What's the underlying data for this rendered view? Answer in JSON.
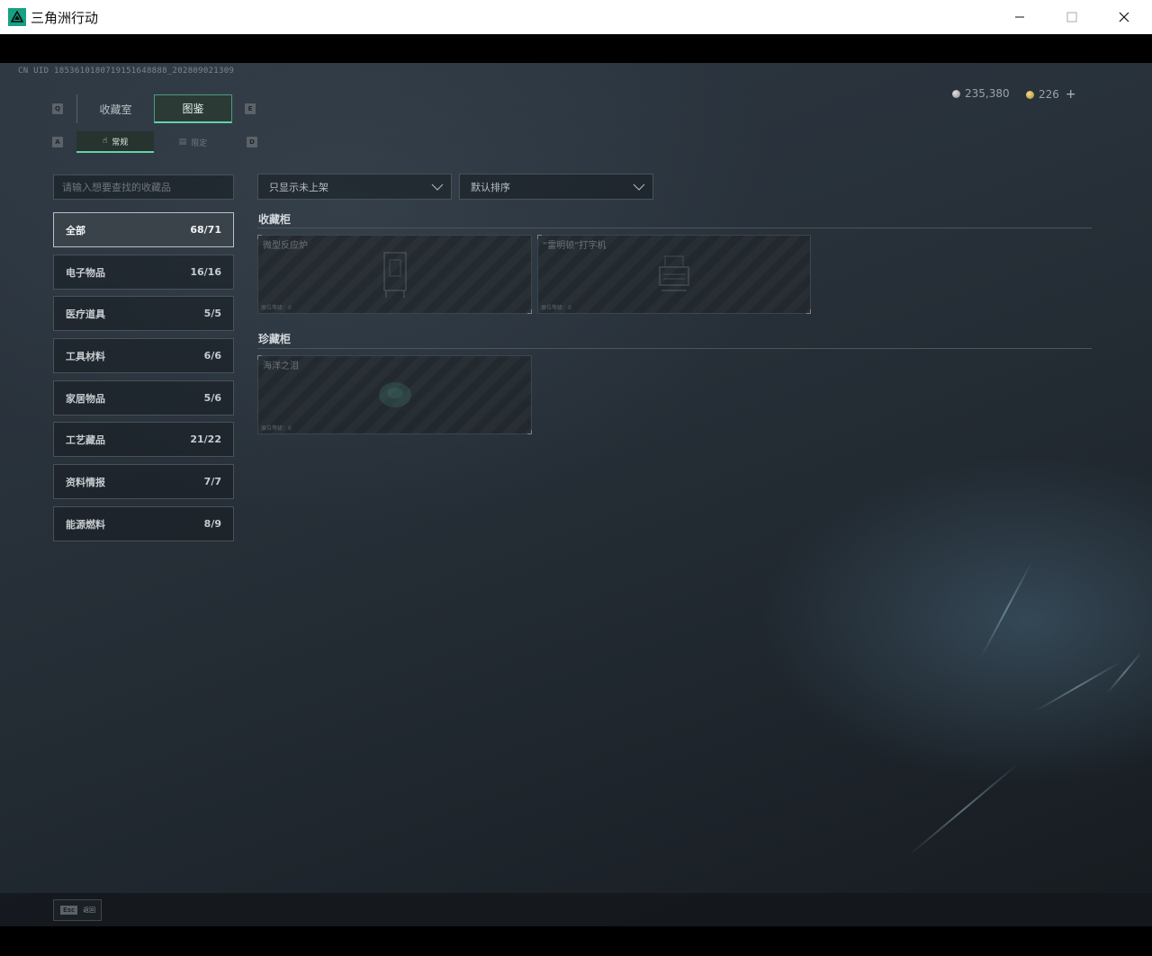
{
  "window": {
    "title": "三角洲行动",
    "minimize_glyph": "—",
    "maximize_glyph": "☐",
    "close_glyph": "✕"
  },
  "header": {
    "uid": "CN UID 1853610180719151648888_202809021309",
    "currency": {
      "silver": "235,380",
      "gold": "226",
      "plus": "+"
    }
  },
  "tabs": {
    "key_left": "Q",
    "key_right": "E",
    "items": [
      {
        "label": "收藏室"
      },
      {
        "label": "图鉴"
      }
    ]
  },
  "subtabs": {
    "key_left": "A",
    "key_right": "D",
    "items": [
      {
        "label": "常规",
        "icon": "hand-icon"
      },
      {
        "label": "限定",
        "icon": "box-icon"
      }
    ]
  },
  "search": {
    "placeholder": "请输入想要查找的收藏品"
  },
  "categories": [
    {
      "label": "全部",
      "count": "68/71"
    },
    {
      "label": "电子物品",
      "count": "16/16"
    },
    {
      "label": "医疗道具",
      "count": "5/5"
    },
    {
      "label": "工具材料",
      "count": "6/6"
    },
    {
      "label": "家居物品",
      "count": "5/6"
    },
    {
      "label": "工艺藏品",
      "count": "21/22"
    },
    {
      "label": "资料情报",
      "count": "7/7"
    },
    {
      "label": "能源燃料",
      "count": "8/9"
    }
  ],
  "filters": {
    "filter_selected": "只显示未上架",
    "sort_selected": "默认排序"
  },
  "sections": [
    {
      "title": "收藏柜",
      "items": [
        {
          "name": "微型反应炉",
          "level": "展位等级：0"
        },
        {
          "name": "“雷明顿”打字机",
          "level": "展位等级：0"
        }
      ]
    },
    {
      "title": "珍藏柜",
      "items": [
        {
          "name": "海洋之泪",
          "level": "展位等级：0"
        }
      ]
    }
  ],
  "footer": {
    "esc_key": "Esc",
    "esc_label": "返回"
  }
}
